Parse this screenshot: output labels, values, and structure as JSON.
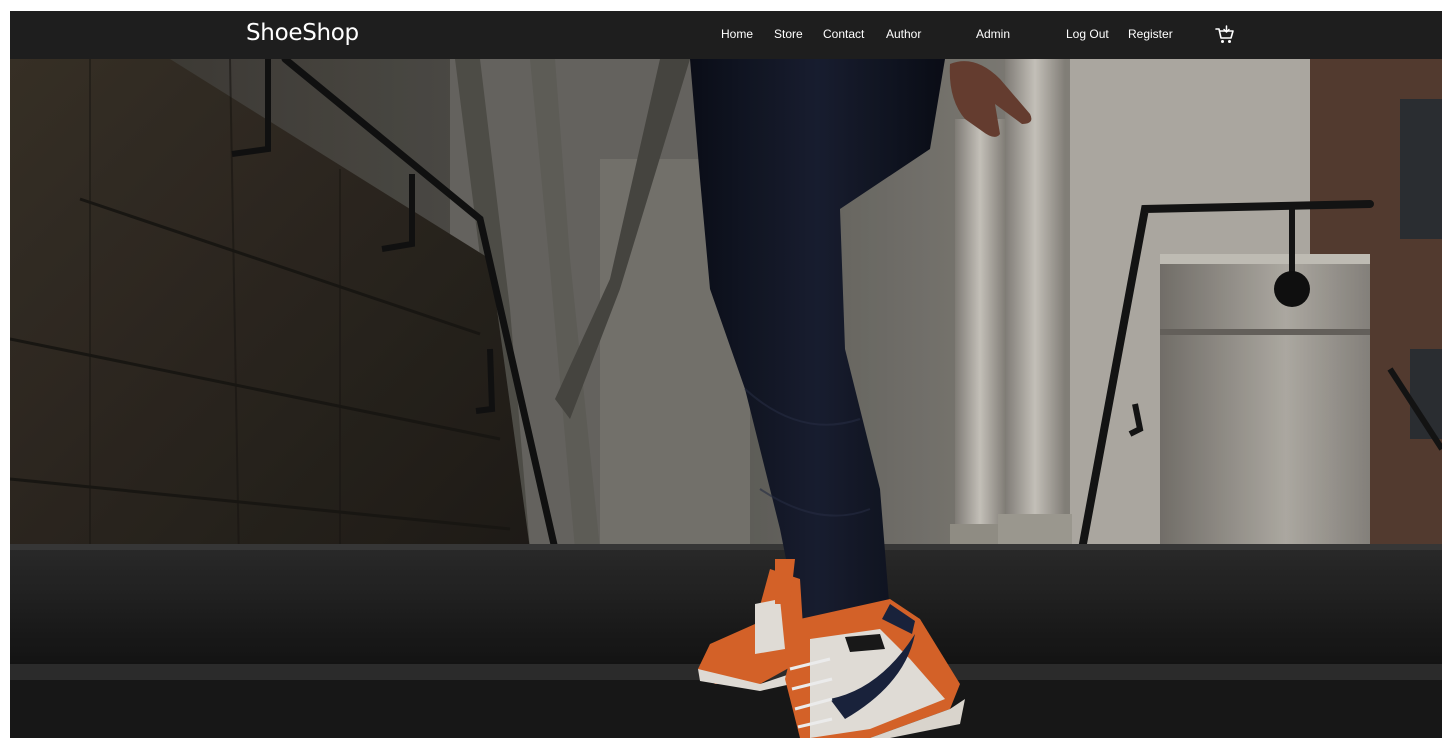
{
  "brand": {
    "name": "ShoeShop"
  },
  "nav": {
    "home": "Home",
    "store": "Store",
    "contact": "Contact",
    "author": "Author",
    "admin": "Admin",
    "logout": "Log Out",
    "register": "Register",
    "cart_icon": "shopping-cart-icon"
  },
  "hero": {
    "image": "hero-image: person climbing stone stairs wearing orange and white high-top sneakers and dark jeans"
  },
  "colors": {
    "navbar_bg": "#1e1e1e",
    "nav_text": "#ffffff",
    "sneaker_orange": "#e56a2c",
    "sneaker_navy": "#1c2540"
  }
}
